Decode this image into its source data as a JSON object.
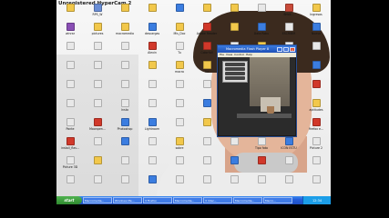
{
  "watermark": {
    "text": "Unregistered HyperCam 2"
  },
  "desktop_icons": [
    {
      "label": "",
      "color": "#f2c84b"
    },
    {
      "label": "RPS_W",
      "color": "#6a8ed6"
    },
    {
      "label": "",
      "color": "#f2c84b"
    },
    {
      "label": "",
      "color": "#f2c84b"
    },
    {
      "label": "",
      "color": "#3b7de0"
    },
    {
      "label": "",
      "color": "#f2c84b"
    },
    {
      "label": "",
      "color": "#f2c84b"
    },
    {
      "label": "",
      "color": "#e8e8e8"
    },
    {
      "label": "Brick...",
      "color": "#c94b3a"
    },
    {
      "label": "Ingresos",
      "color": "#f2c84b"
    },
    {
      "label": "winrar",
      "color": "#8a4fb5"
    },
    {
      "label": "pictures",
      "color": "#f2c84b"
    },
    {
      "label": "macromedia",
      "color": "#f2c84b"
    },
    {
      "label": "descargas",
      "color": "#3b7de0"
    },
    {
      "label": "Mis_Doc",
      "color": "#f2c84b"
    },
    {
      "label": "Adobe Reader",
      "color": "#d1382a"
    },
    {
      "label": "",
      "color": "#f2c84b"
    },
    {
      "label": "Data Roku",
      "color": "#3b7de0"
    },
    {
      "label": "ESCRIBIR",
      "color": "#e8e8e8"
    },
    {
      "label": "Nuevo",
      "color": "#3b7de0"
    },
    {
      "label": "",
      "color": "#e8e8e8"
    },
    {
      "label": "",
      "color": "#e8e8e8"
    },
    {
      "label": "",
      "color": "#e8e8e8"
    },
    {
      "label": "Alexin",
      "color": "#d1382a"
    },
    {
      "label": "Tu",
      "color": "#e8e8e8"
    },
    {
      "label": "Colorfull",
      "color": "#d1382a"
    },
    {
      "label": "ADOBE 1...",
      "color": "#e8e8e8"
    },
    {
      "label": "PALETTE",
      "color": "#f2c84b"
    },
    {
      "label": "",
      "color": "#e8e8e8"
    },
    {
      "label": "",
      "color": "#e8e8e8"
    },
    {
      "label": "",
      "color": "#e8e8e8"
    },
    {
      "label": "",
      "color": "#e8e8e8"
    },
    {
      "label": "",
      "color": "#e8e8e8"
    },
    {
      "label": "",
      "color": "#f2c84b"
    },
    {
      "label": "macro",
      "color": "#f2c84b"
    },
    {
      "label": "tu",
      "color": "#f2c84b"
    },
    {
      "label": "data",
      "color": "#f2c84b"
    },
    {
      "label": "",
      "color": "#f2c84b"
    },
    {
      "label": "",
      "color": "#f2c84b"
    },
    {
      "label": "",
      "color": "#3b7de0"
    },
    {
      "label": "",
      "color": "#e8e8e8"
    },
    {
      "label": "",
      "color": "#e8e8e8"
    },
    {
      "label": "",
      "color": "#e8e8e8"
    },
    {
      "label": "",
      "color": "#e8e8e8"
    },
    {
      "label": "",
      "color": "#e8e8e8"
    },
    {
      "label": "",
      "color": "#e8e8e8"
    },
    {
      "label": "",
      "color": "#e8e8e8"
    },
    {
      "label": "",
      "color": "#e8e8e8"
    },
    {
      "label": "",
      "color": "#e8e8e8"
    },
    {
      "label": "",
      "color": "#d1382a"
    },
    {
      "label": "",
      "color": "#e8e8e8"
    },
    {
      "label": "",
      "color": "#e8e8e8"
    },
    {
      "label": "Insta",
      "color": "#e8e8e8"
    },
    {
      "label": "",
      "color": "#e8e8e8"
    },
    {
      "label": "",
      "color": "#e8e8e8"
    },
    {
      "label": "",
      "color": "#3b7de0"
    },
    {
      "label": "insta",
      "color": "#3b7de0"
    },
    {
      "label": "",
      "color": "#e8e8e8"
    },
    {
      "label": "",
      "color": "#e8e8e8"
    },
    {
      "label": "aptitudes",
      "color": "#f2c84b"
    },
    {
      "label": "Ponte",
      "color": "#e8e8e8"
    },
    {
      "label": "Moonpen...",
      "color": "#d1382a"
    },
    {
      "label": "Photoshop",
      "color": "#3b7de0"
    },
    {
      "label": "Lightroom",
      "color": "#3b7de0"
    },
    {
      "label": "",
      "color": "#e8e8e8"
    },
    {
      "label": "",
      "color": "#f2c84b"
    },
    {
      "label": "",
      "color": "#e8e8e8"
    },
    {
      "label": "",
      "color": "#e8e8e8"
    },
    {
      "label": "buscar",
      "color": "#e8e8e8"
    },
    {
      "label": "firefox e...",
      "color": "#d1382a"
    },
    {
      "label": "install_flas...",
      "color": "#d1382a"
    },
    {
      "label": "",
      "color": "#e8e8e8"
    },
    {
      "label": "",
      "color": "#3b7de0"
    },
    {
      "label": "",
      "color": "#e8e8e8"
    },
    {
      "label": "sobre",
      "color": "#f2c84b"
    },
    {
      "label": "",
      "color": "#e8e8e8"
    },
    {
      "label": "",
      "color": "#e8e8e8"
    },
    {
      "label": "Tipo foto",
      "color": "#e8e8e8"
    },
    {
      "label": "ICON ESTU",
      "color": "#3b7de0"
    },
    {
      "label": "Picture 2",
      "color": "#e8e8e8"
    },
    {
      "label": "Picture 3D",
      "color": "#e8e8e8"
    },
    {
      "label": "",
      "color": "#f2c84b"
    },
    {
      "label": "",
      "color": "#e8e8e8"
    },
    {
      "label": "",
      "color": "#e8e8e8"
    },
    {
      "label": "",
      "color": "#e8e8e8"
    },
    {
      "label": "",
      "color": "#e8e8e8"
    },
    {
      "label": "",
      "color": "#3b7de0"
    },
    {
      "label": "",
      "color": "#d1382a"
    },
    {
      "label": "",
      "color": "#e8e8e8"
    },
    {
      "label": "",
      "color": "#e8e8e8"
    },
    {
      "label": "",
      "color": "#e8e8e8"
    },
    {
      "label": "",
      "color": "#e8e8e8"
    },
    {
      "label": "",
      "color": "#e8e8e8"
    },
    {
      "label": "",
      "color": "#3b7de0"
    },
    {
      "label": "",
      "color": "#e8e8e8"
    },
    {
      "label": "",
      "color": "#e8e8e8"
    },
    {
      "label": "",
      "color": "#e8e8e8"
    },
    {
      "label": "",
      "color": "#e8e8e8"
    },
    {
      "label": "",
      "color": "#e8e8e8"
    },
    {
      "label": "",
      "color": "#e8e8e8"
    }
  ],
  "player": {
    "title": "Macromedia Flash Player 8",
    "min_glyph": "_",
    "max_glyph": "□",
    "close_glyph": "×",
    "menus": [
      "File",
      "View",
      "Control",
      "Help"
    ]
  },
  "taskbar": {
    "start_label": "start",
    "buttons": [
      "Macromedia...",
      "Windows Me...",
      "3 Firefox",
      "Macromedia...",
      "3 Inter...",
      "Macromedia...",
      "Macro..."
    ],
    "clock": "12:34"
  }
}
